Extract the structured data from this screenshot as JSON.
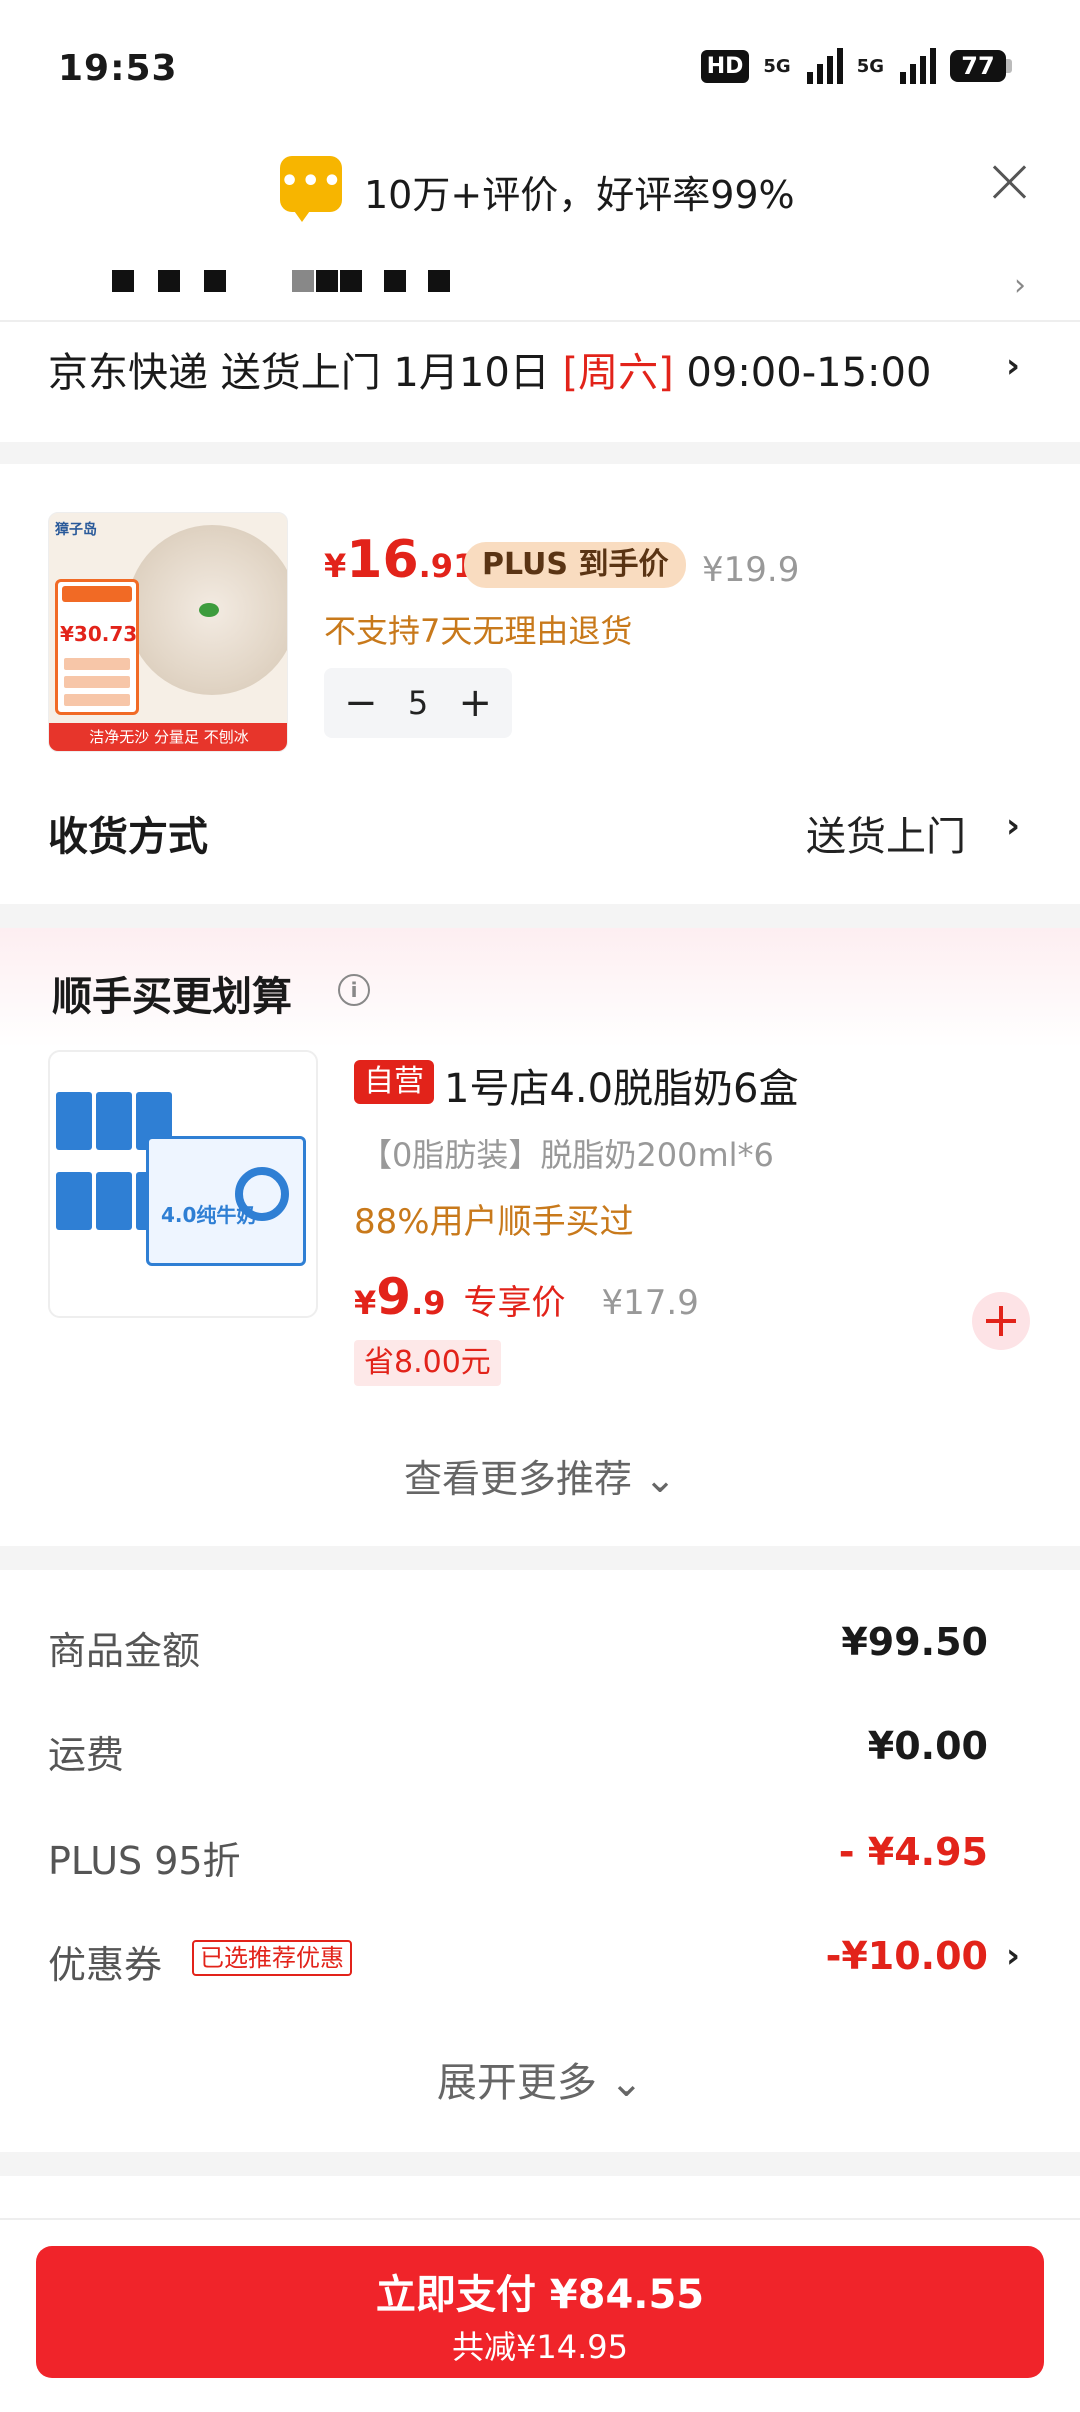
{
  "status_bar": {
    "time": "19:53",
    "hd": "HD",
    "network_1": "5G",
    "network_2": "5G",
    "battery": "77"
  },
  "review_banner": {
    "icon": "chat-bubble-icon",
    "text": "10万+评价，好评率99%",
    "icon_color": "#f7b500"
  },
  "delivery": {
    "carrier": "京东快递 送货上门 1月10日 ",
    "weekday": "[周六]",
    "time_window": " 09:00-15:00"
  },
  "product": {
    "image_footer": "洁净无沙 分量足 不刨冰",
    "image_brand": "獐子岛",
    "image_price": "¥30.73",
    "price_currency": "¥",
    "price_integer": "16",
    "price_decimal": ".91",
    "plus_badge": "PLUS 到手价",
    "original_price": "¥19.9",
    "return_policy": "不支持7天无理由退货",
    "quantity": "5",
    "minus": "−",
    "plus": "+"
  },
  "receive": {
    "label": "收货方式",
    "value": "送货上门"
  },
  "recommend": {
    "title": "顺手买更划算",
    "item": {
      "badge": "自营",
      "title": "1号店4.0脱脂奶6盒",
      "description": "【0脂肪装】脱脂奶200ml*6",
      "bought": "88%用户顺手买过",
      "price_currency": "¥",
      "price_integer": "9",
      "price_decimal": ".9",
      "price_label": "专享价",
      "original_price": "¥17.9",
      "save": "省8.00元",
      "image_box_label": "4.0纯牛奶"
    },
    "more": "查看更多推荐 ⌄"
  },
  "summary": {
    "rows": [
      {
        "label": "商品金额",
        "value": "¥99.50"
      },
      {
        "label": "运费",
        "value": "¥0.00"
      },
      {
        "label": "PLUS 95折",
        "value": "- ¥4.95"
      },
      {
        "label": "优惠券",
        "value": "-¥10.00",
        "tag": "已选推荐优惠"
      }
    ],
    "expand": "展开更多 ⌄"
  },
  "pay": {
    "main": "立即支付 ¥84.55",
    "sub": "共减¥14.95",
    "color": "#f0242a"
  },
  "colors": {
    "accent": "#e2231a",
    "orange_text": "#c8791b"
  }
}
